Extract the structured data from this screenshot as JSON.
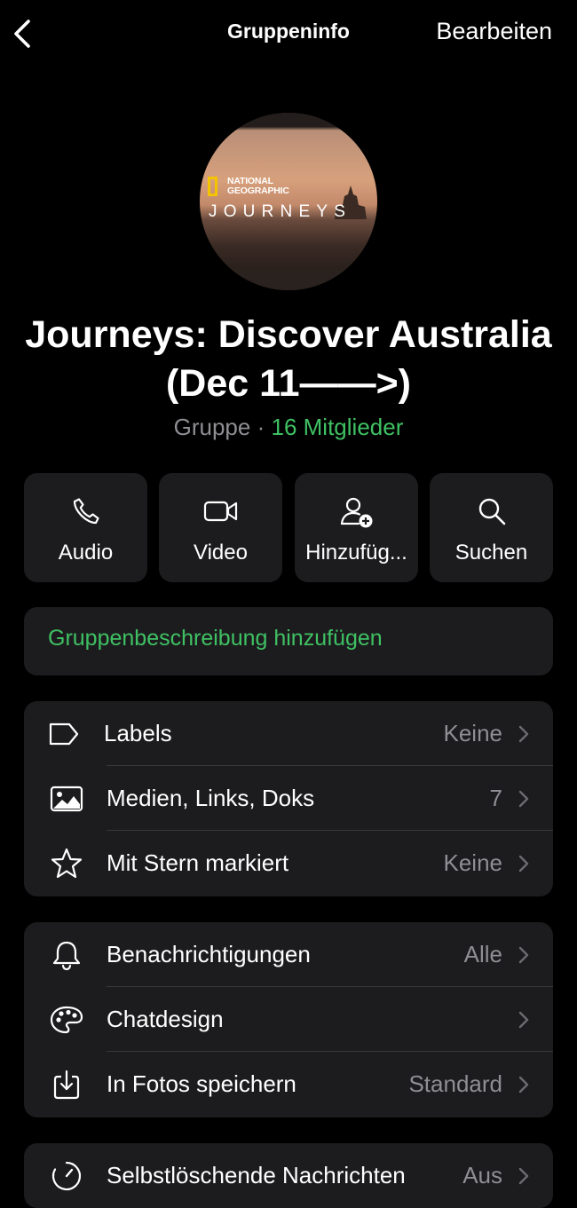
{
  "nav": {
    "back_icon": "chevron-left-icon",
    "title": "Gruppeninfo",
    "edit_label": "Bearbeiten"
  },
  "avatar": {
    "brand_line1": "NATIONAL",
    "brand_line2": "GEOGRAPHIC",
    "brand_title": "JOURNEYS"
  },
  "group": {
    "name_line1": "Journeys: Discover Australia",
    "name_line2": "(Dec 11——>)",
    "type": "Gruppe",
    "separator": "·",
    "members": "16 Mitglieder"
  },
  "actions": [
    {
      "label": "Audio",
      "icon": "phone-icon"
    },
    {
      "label": "Video",
      "icon": "video-camera-icon"
    },
    {
      "label": "Hinzufüg...",
      "icon": "add-person-icon"
    },
    {
      "label": "Suchen",
      "icon": "search-icon"
    }
  ],
  "description": {
    "add_label": "Gruppenbeschreibung hinzufügen"
  },
  "section1": [
    {
      "label": "Labels",
      "value": "Keine",
      "icon": "label-tag-icon"
    },
    {
      "label": "Medien, Links, Doks",
      "value": "7",
      "icon": "photo-icon"
    },
    {
      "label": "Mit Stern markiert",
      "value": "Keine",
      "icon": "star-icon"
    }
  ],
  "section2": [
    {
      "label": "Benachrichtigungen",
      "value": "Alle",
      "icon": "bell-icon"
    },
    {
      "label": "Chatdesign",
      "value": "",
      "icon": "palette-icon"
    },
    {
      "label": "In Fotos speichern",
      "value": "Standard",
      "icon": "save-download-icon"
    }
  ],
  "section3": [
    {
      "label": "Selbstlöschende Nachrichten",
      "value": "Aus",
      "icon": "timer-icon"
    }
  ],
  "colors": {
    "background": "#000000",
    "card": "#1c1c1e",
    "accent_green": "#3fc163",
    "secondary_text": "#8e8e93"
  }
}
